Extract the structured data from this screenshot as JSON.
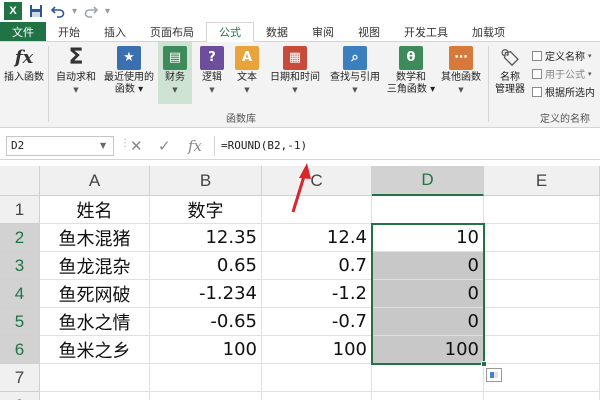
{
  "app": {
    "logo_text": "X"
  },
  "tabs": {
    "file": "文件",
    "items": [
      "开始",
      "插入",
      "页面布局",
      "公式",
      "数据",
      "审阅",
      "视图",
      "开发工具",
      "加载项"
    ],
    "active_index": 3
  },
  "ribbon": {
    "insert_function": "插入函数",
    "autosum": "自动求和",
    "recent_line1": "最近使用的",
    "recent_line2": "函数",
    "finance": "财务",
    "logic": "逻辑",
    "text": "文本",
    "datetime": "日期和时间",
    "lookup": "查找与引用",
    "math_line1": "数学和",
    "math_line2": "三角函数",
    "other": "其他函数",
    "group_library": "函数库",
    "name_mgr_line1": "名称",
    "name_mgr_line2": "管理器",
    "define_name": "定义名称",
    "use_in_formula": "用于公式",
    "create_from_sel": "根据所选内",
    "group_names": "定义的名称"
  },
  "formula_bar": {
    "name_box": "D2",
    "fx": "fx",
    "formula": "=ROUND(B2,-1)"
  },
  "grid": {
    "columns": [
      "A",
      "B",
      "C",
      "D",
      "E"
    ],
    "selected_column": "D",
    "rows": [
      "1",
      "2",
      "3",
      "4",
      "5",
      "6",
      "7",
      "8"
    ],
    "cells": {
      "A1": "姓名",
      "B1": "数字",
      "A2": "鱼木混猪",
      "B2": "12.35",
      "C2": "12.4",
      "D2": "10",
      "A3": "鱼龙混杂",
      "B3": "0.65",
      "C3": "0.7",
      "D3": "0",
      "A4": "鱼死网破",
      "B4": "-1.234",
      "C4": "-1.2",
      "D4": "0",
      "A5": "鱼水之情",
      "B5": "-0.65",
      "C5": "-0.7",
      "D5": "0",
      "A6": "鱼米之乡",
      "B6": "100",
      "C6": "100",
      "D6": "100"
    }
  },
  "colors": {
    "excel_green": "#217346",
    "highlight_fill": "#c8c8c8",
    "arrow_red": "#d9262b"
  },
  "icons": {
    "logo": "excel-logo-icon",
    "save": "save-icon",
    "undo": "undo-icon",
    "redo": "redo-icon"
  }
}
